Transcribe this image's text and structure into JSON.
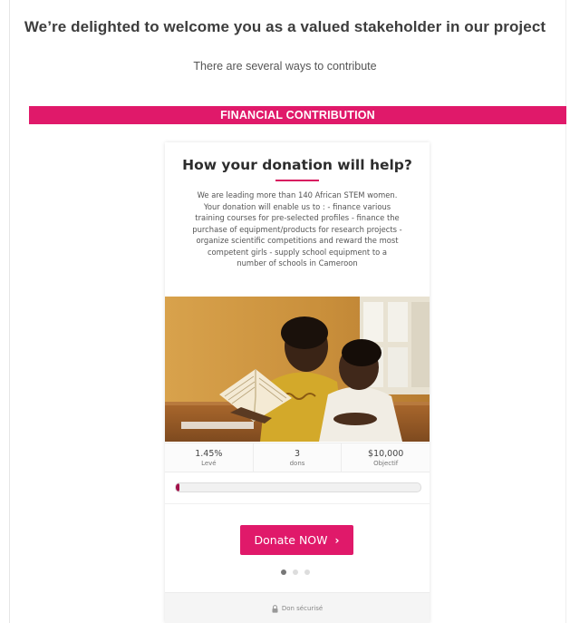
{
  "header": {
    "welcome": "We’re delighted to welcome you as a valued stakeholder in our project",
    "subtitle": "There are several ways to contribute"
  },
  "banner": {
    "label": "FINANCIAL CONTRIBUTION",
    "color": "#e0196a"
  },
  "card": {
    "title": "How your donation will help?",
    "description": "We are leading more than 140 African STEM women. Your donation will enable us to : - finance various training courses for pre-selected profiles - finance the purchase of equipment/products for research projects - organize scientific competitions and reward the most competent girls - supply school equipment to a number of schools in Cameroon",
    "stats": [
      {
        "value": "1.45%",
        "label": "Levé"
      },
      {
        "value": "3",
        "label": "dons"
      },
      {
        "value": "$10,000",
        "label": "Objectif"
      }
    ],
    "progress_percent": 1.45,
    "donate_label": "Donate NOW",
    "donate_icon": "chevron-right-icon",
    "carousel": {
      "count": 3,
      "active": 0
    },
    "secure_label": "Don sécurisé",
    "secure_icon": "lock-icon"
  },
  "colors": {
    "accent": "#e0196a",
    "progress": "#a3124b"
  }
}
